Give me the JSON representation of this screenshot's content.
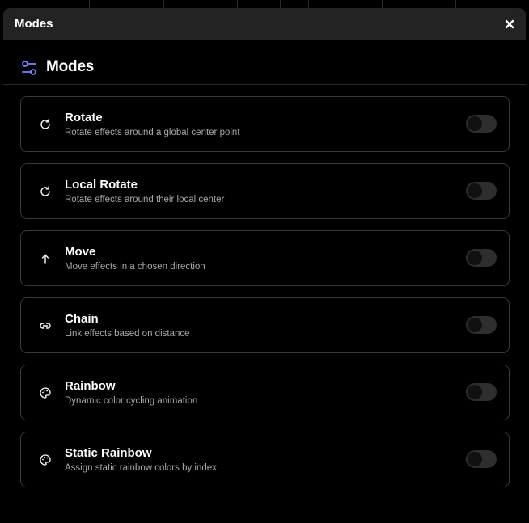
{
  "window": {
    "title": "Modes",
    "close_glyph": "×"
  },
  "header": {
    "title": "Modes",
    "icon": "sliders-icon",
    "accent_color": "#7b86ff"
  },
  "modes": [
    {
      "title": "Rotate",
      "description": "Rotate effects around a global center point",
      "icon": "rotate-icon",
      "enabled": false
    },
    {
      "title": "Local Rotate",
      "description": "Rotate effects around their local center",
      "icon": "rotate-icon",
      "enabled": false
    },
    {
      "title": "Move",
      "description": "Move effects in a chosen direction",
      "icon": "arrow-up-icon",
      "enabled": false
    },
    {
      "title": "Chain",
      "description": "Link effects based on distance",
      "icon": "link-icon",
      "enabled": false
    },
    {
      "title": "Rainbow",
      "description": "Dynamic color cycling animation",
      "icon": "palette-icon",
      "enabled": false
    },
    {
      "title": "Static Rainbow",
      "description": "Assign static rainbow colors by index",
      "icon": "palette-icon",
      "enabled": false
    }
  ]
}
